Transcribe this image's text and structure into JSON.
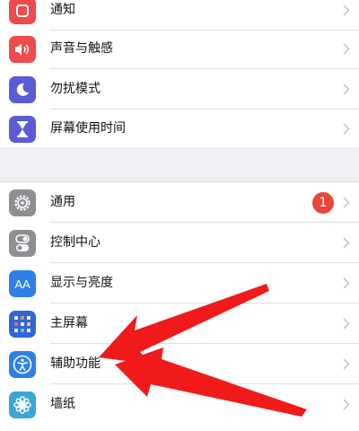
{
  "settings": {
    "group1": [
      {
        "label": "通知",
        "icon": "bell-icon",
        "color": "#ef4a4d"
      },
      {
        "label": "声音与触感",
        "icon": "speaker-icon",
        "color": "#ef4a4d"
      },
      {
        "label": "勿扰模式",
        "icon": "moon-icon",
        "color": "#5b5bd6"
      },
      {
        "label": "屏幕使用时间",
        "icon": "hourglass-icon",
        "color": "#5b5bd6"
      }
    ],
    "group2": [
      {
        "label": "通用",
        "icon": "gear-icon",
        "color": "#8e8e93",
        "badge": "1"
      },
      {
        "label": "控制中心",
        "icon": "toggles-icon",
        "color": "#8e8e93"
      },
      {
        "label": "显示与亮度",
        "icon": "text-size-icon",
        "color": "#2f7fe8",
        "glyph": "AA"
      },
      {
        "label": "主屏幕",
        "icon": "home-grid-icon",
        "color": "#3166d8"
      },
      {
        "label": "辅助功能",
        "icon": "accessibility-icon",
        "color": "#2f7fe8"
      },
      {
        "label": "墙纸",
        "icon": "flower-icon",
        "color": "#3ba7d9"
      }
    ]
  },
  "colors": {
    "chevron": "#c7c7cc",
    "arrow": "#f01a1a"
  }
}
